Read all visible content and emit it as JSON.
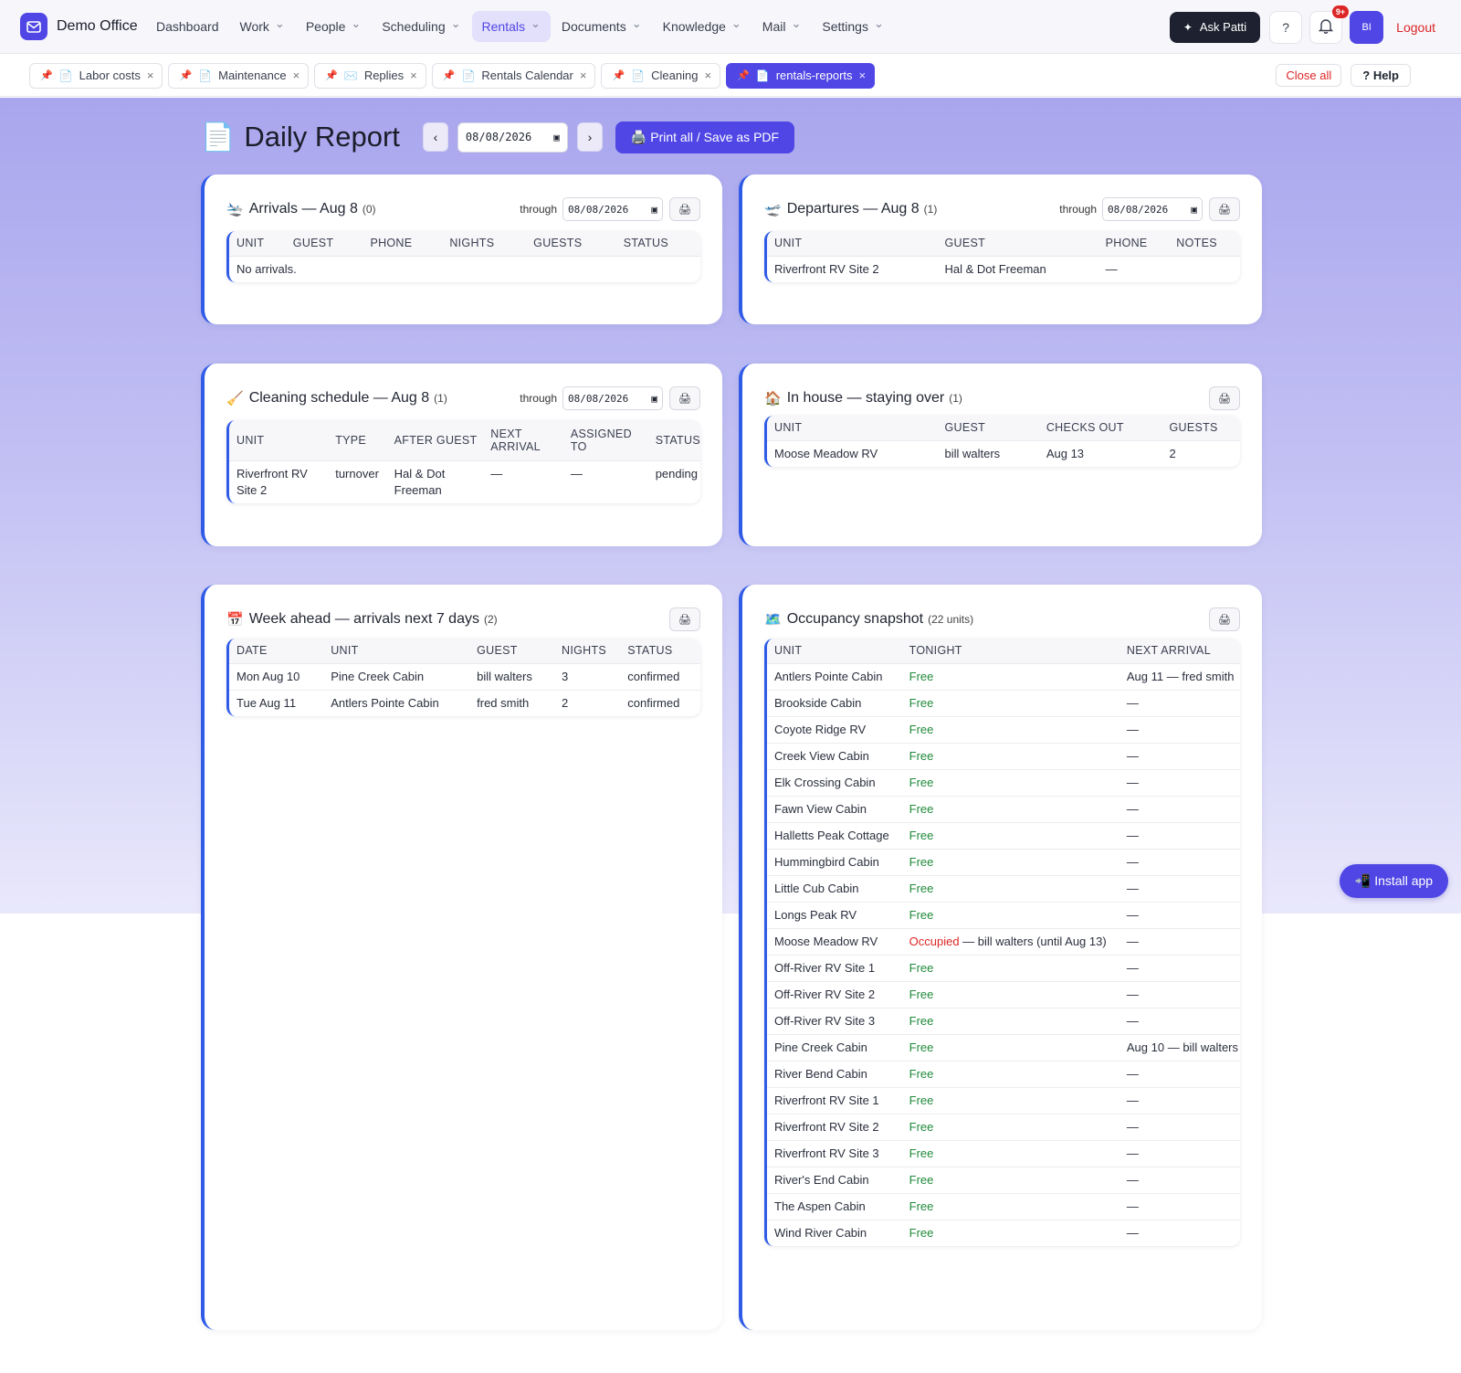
{
  "app": {
    "name": "Demo Office"
  },
  "nav": {
    "items": [
      {
        "label": "Dashboard",
        "chevron": false
      },
      {
        "label": "Work",
        "chevron": true
      },
      {
        "label": "People",
        "chevron": true
      },
      {
        "label": "Scheduling",
        "chevron": true
      },
      {
        "label": "Rentals",
        "chevron": true,
        "active": true
      },
      {
        "label": "Documents",
        "chevron": true
      },
      {
        "label": "Knowledge",
        "chevron": true
      },
      {
        "label": "Mail",
        "chevron": true
      },
      {
        "label": "Settings",
        "chevron": true
      }
    ],
    "ask_label": "Ask Patti",
    "help_icon_label": "?",
    "notif_badge": "9+",
    "avatar_initials": "BI",
    "logout_label": "Logout"
  },
  "tabs": {
    "items": [
      {
        "label": "Labor costs",
        "icon": "document-icon"
      },
      {
        "label": "Maintenance",
        "icon": "document-icon"
      },
      {
        "label": "Replies",
        "icon": "mail-icon"
      },
      {
        "label": "Rentals Calendar",
        "icon": "document-icon"
      },
      {
        "label": "Cleaning",
        "icon": "document-icon"
      },
      {
        "label": "rentals-reports",
        "icon": "document-icon",
        "active": true
      }
    ],
    "close_all_label": "Close all",
    "help_label": "? Help"
  },
  "page": {
    "title": "Daily Report",
    "prev_label": "‹",
    "next_label": "›",
    "date": "08/08/2026",
    "print_all_label": "🖨️ Print all / Save as PDF"
  },
  "arrivals": {
    "title": "Arrivals",
    "date_label": "— Aug 8",
    "count": "(0)",
    "through_label": "through",
    "through_date": "08/08/2026",
    "columns": [
      "UNIT",
      "GUEST",
      "PHONE",
      "NIGHTS",
      "GUESTS",
      "STATUS"
    ],
    "empty_text": "No arrivals."
  },
  "departures": {
    "title": "Departures",
    "date_label": "— Aug 8",
    "count": "(1)",
    "through_label": "through",
    "through_date": "08/08/2026",
    "columns": [
      "UNIT",
      "GUEST",
      "PHONE",
      "NOTES"
    ],
    "rows": [
      [
        "Riverfront RV Site 2",
        "Hal & Dot Freeman",
        "—",
        ""
      ]
    ]
  },
  "cleaning": {
    "title": "Cleaning schedule",
    "date_label": "— Aug 8",
    "count": "(1)",
    "through_label": "through",
    "through_date": "08/08/2026",
    "columns": [
      "UNIT",
      "TYPE",
      "AFTER GUEST",
      "NEXT ARRIVAL",
      "ASSIGNED TO",
      "STATUS"
    ],
    "rows": [
      [
        "Riverfront RV Site 2",
        "turnover",
        "Hal & Dot Freeman",
        "—",
        "—",
        "pending"
      ]
    ]
  },
  "in_house": {
    "title": "In house",
    "date_label": "— staying over",
    "count": "(1)",
    "columns": [
      "UNIT",
      "GUEST",
      "CHECKS OUT",
      "GUESTS"
    ],
    "rows": [
      [
        "Moose Meadow RV",
        "bill walters",
        "Aug 13",
        "2"
      ]
    ]
  },
  "week_ahead": {
    "title": "Week ahead",
    "date_label": "— arrivals next 7 days",
    "count": "(2)",
    "columns": [
      "DATE",
      "UNIT",
      "GUEST",
      "NIGHTS",
      "STATUS"
    ],
    "rows": [
      [
        "Mon Aug 10",
        "Pine Creek Cabin",
        "bill walters",
        "3",
        "confirmed"
      ],
      [
        "Tue Aug 11",
        "Antlers Pointe Cabin",
        "fred smith",
        "2",
        "confirmed"
      ]
    ]
  },
  "occupancy": {
    "title": "Occupancy snapshot",
    "count": "(22 units)",
    "columns": [
      "UNIT",
      "TONIGHT",
      "NEXT ARRIVAL"
    ],
    "rows": [
      {
        "unit": "Antlers Pointe Cabin",
        "status": "Free",
        "detail": "",
        "next": "Aug 11 — fred smith"
      },
      {
        "unit": "Brookside Cabin",
        "status": "Free",
        "detail": "",
        "next": "—"
      },
      {
        "unit": "Coyote Ridge RV",
        "status": "Free",
        "detail": "",
        "next": "—"
      },
      {
        "unit": "Creek View Cabin",
        "status": "Free",
        "detail": "",
        "next": "—"
      },
      {
        "unit": "Elk Crossing Cabin",
        "status": "Free",
        "detail": "",
        "next": "—"
      },
      {
        "unit": "Fawn View Cabin",
        "status": "Free",
        "detail": "",
        "next": "—"
      },
      {
        "unit": "Halletts Peak Cottage",
        "status": "Free",
        "detail": "",
        "next": "—"
      },
      {
        "unit": "Hummingbird Cabin",
        "status": "Free",
        "detail": "",
        "next": "—"
      },
      {
        "unit": "Little Cub Cabin",
        "status": "Free",
        "detail": "",
        "next": "—"
      },
      {
        "unit": "Longs Peak RV",
        "status": "Free",
        "detail": "",
        "next": "—"
      },
      {
        "unit": "Moose Meadow RV",
        "status": "Occupied",
        "detail": "— bill walters (until Aug 13)",
        "next": "—"
      },
      {
        "unit": "Off-River RV Site 1",
        "status": "Free",
        "detail": "",
        "next": "—"
      },
      {
        "unit": "Off-River RV Site 2",
        "status": "Free",
        "detail": "",
        "next": "—"
      },
      {
        "unit": "Off-River RV Site 3",
        "status": "Free",
        "detail": "",
        "next": "—"
      },
      {
        "unit": "Pine Creek Cabin",
        "status": "Free",
        "detail": "",
        "next": "Aug 10 — bill walters"
      },
      {
        "unit": "River Bend Cabin",
        "status": "Free",
        "detail": "",
        "next": "—"
      },
      {
        "unit": "Riverfront RV Site 1",
        "status": "Free",
        "detail": "",
        "next": "—"
      },
      {
        "unit": "Riverfront RV Site 2",
        "status": "Free",
        "detail": "",
        "next": "—"
      },
      {
        "unit": "Riverfront RV Site 3",
        "status": "Free",
        "detail": "",
        "next": "—"
      },
      {
        "unit": "River's End Cabin",
        "status": "Free",
        "detail": "",
        "next": "—"
      },
      {
        "unit": "The Aspen Cabin",
        "status": "Free",
        "detail": "",
        "next": "—"
      },
      {
        "unit": "Wind River Cabin",
        "status": "Free",
        "detail": "",
        "next": "—"
      }
    ]
  },
  "install_label": "📲 Install app",
  "colors": {
    "accent": "#4f46e5",
    "card_border": "#2f5be7",
    "free": "#1f8a3a",
    "occupied": "#dc2626"
  }
}
